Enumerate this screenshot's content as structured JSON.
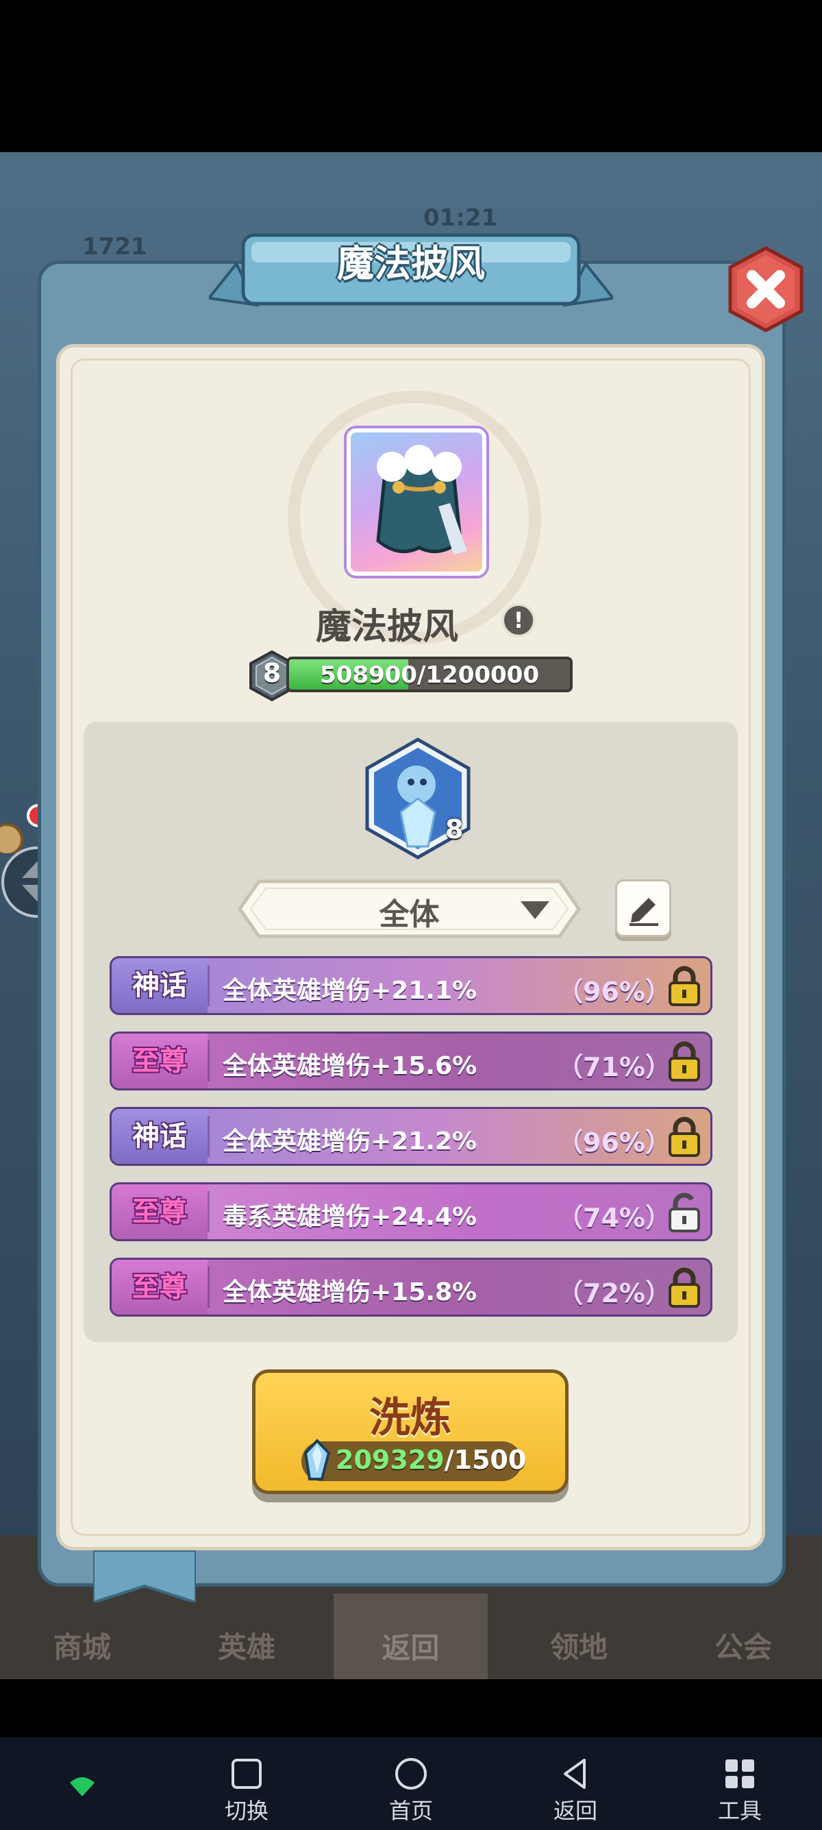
{
  "hud": {
    "gems": "1721",
    "timer": "01:21"
  },
  "modal": {
    "title": "魔法披风",
    "item_name": "魔法披风",
    "level": "8",
    "xp_text": "508900/1200000",
    "xp_progress": 0.424,
    "hero_level": "8",
    "filter": {
      "selected": "全体"
    }
  },
  "stats": [
    {
      "tier": "神话",
      "text": "全体英雄增伤+21.1%",
      "percent": "（96%）",
      "locked": true
    },
    {
      "tier": "至尊",
      "text": "全体英雄增伤+15.6%",
      "percent": "（71%）",
      "locked": true
    },
    {
      "tier": "神话",
      "text": "全体英雄增伤+21.2%",
      "percent": "（96%）",
      "locked": true
    },
    {
      "tier": "至尊",
      "text": "毒系英雄增伤+24.4%",
      "percent": "（74%）",
      "locked": false
    },
    {
      "tier": "至尊",
      "text": "全体英雄增伤+15.8%",
      "percent": "（72%）",
      "locked": true
    }
  ],
  "refine": {
    "label": "洗炼",
    "have": "209329",
    "cost": "/1500"
  },
  "game_nav": [
    "商城",
    "英雄",
    "返回",
    "领地",
    "公会"
  ],
  "system_nav": [
    "切换",
    "首页",
    "返回",
    "工具"
  ],
  "colors": {
    "accent": "#f2b92c",
    "myth": "#9a86d8",
    "supreme": "#c071c4",
    "frame": "#6f97ae"
  }
}
